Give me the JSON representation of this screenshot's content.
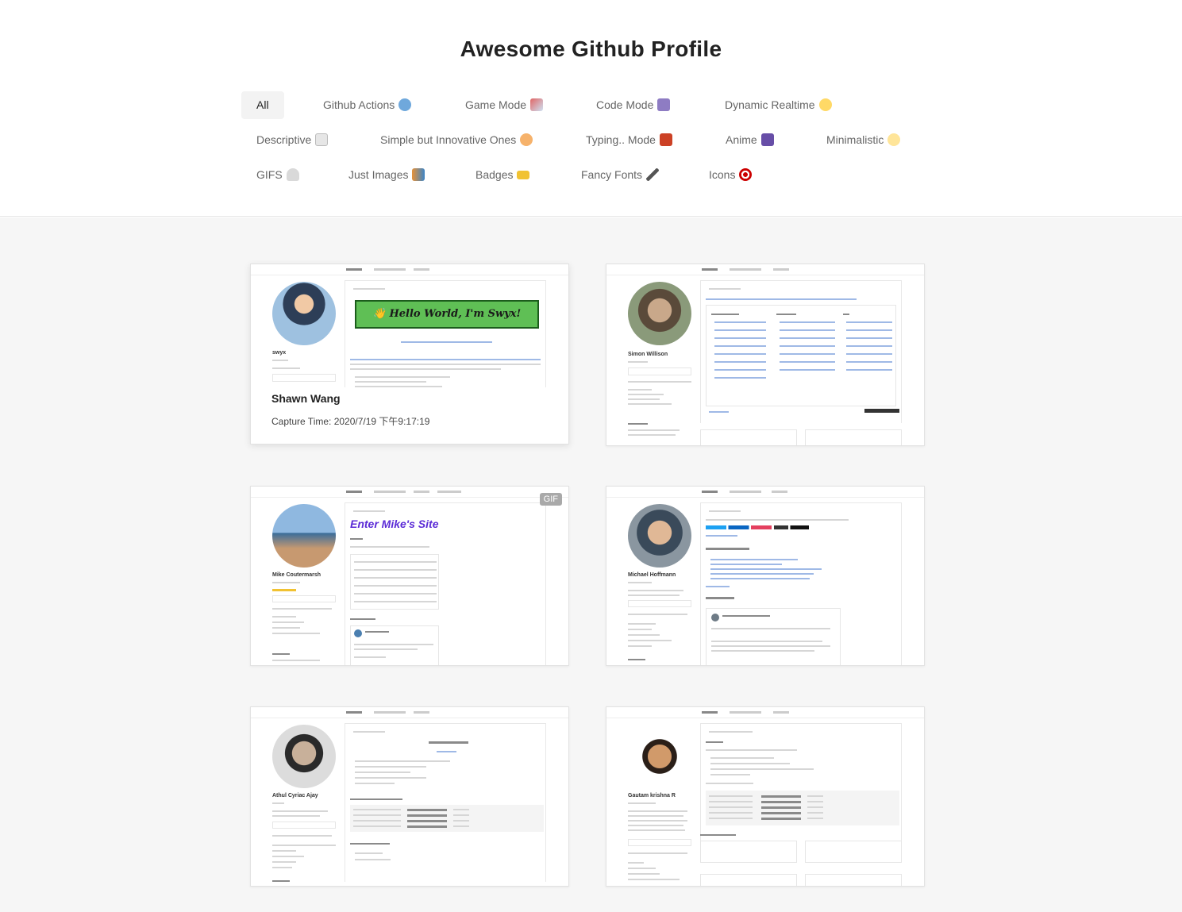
{
  "page": {
    "title": "Awesome Github Profile"
  },
  "filters": {
    "row1": [
      {
        "label": "All",
        "icon": "all",
        "active": true
      },
      {
        "label": "Github Actions",
        "icon": "robot-icon",
        "emoji_color": "#6fa8dc"
      },
      {
        "label": "Game Mode",
        "icon": "rocket-icon",
        "emoji_color": "#e06666"
      },
      {
        "label": "Code Mode",
        "icon": "technologist-icon",
        "emoji_color": "#8e7cc3"
      },
      {
        "label": "Dynamic Realtime",
        "icon": "dizzy-icon",
        "emoji_color": "#ffd966"
      }
    ],
    "row2": [
      {
        "label": "Descriptive",
        "icon": "memo-icon",
        "emoji_color": "#cfcfcf"
      },
      {
        "label": "Simple but Innovative Ones",
        "icon": "hugging-face-icon",
        "emoji_color": "#f6b26b"
      },
      {
        "label": "Typing.. Mode",
        "icon": "slot-machine-icon",
        "emoji_color": "#cc4125"
      },
      {
        "label": "Anime",
        "icon": "alien-monster-icon",
        "emoji_color": "#674ea7"
      },
      {
        "label": "Minimalistic",
        "icon": "sparkles-icon",
        "emoji_color": "#ffe599"
      }
    ],
    "row3": [
      {
        "label": "GIFS",
        "icon": "ghost-icon",
        "emoji_color": "#b7b7b7"
      },
      {
        "label": "Just Images",
        "icon": "performing-arts-icon",
        "emoji_color": "#e69138"
      },
      {
        "label": "Badges",
        "icon": "id-card-icon",
        "emoji_color": "#f1c232"
      },
      {
        "label": "Fancy Fonts",
        "icon": "pen-icon",
        "emoji_color": "#666666"
      },
      {
        "label": "Icons",
        "icon": "direct-hit-icon",
        "emoji_color": "#cc0000"
      }
    ]
  },
  "cards": [
    {
      "owner": "Shawn Wang",
      "capture_time": "Capture Time: 2020/7/19 下午9:17:19",
      "mini_name": "swyx",
      "banner_text": "👋 Hello World, I'm Swyx!",
      "avatar_color": "#5a7ea8",
      "show_info": true,
      "gif": false
    },
    {
      "mini_name": "Simon Willison",
      "avatar_color": "#6b5a4a",
      "show_info": false,
      "gif": false
    },
    {
      "mini_name": "Mike Coutermarsh",
      "banner_text": "Enter Mike's Site",
      "avatar_color": "#4a7fb0",
      "show_info": false,
      "gif": true,
      "gif_label": "GIF"
    },
    {
      "mini_name": "Michael Hoffmann",
      "avatar_color": "#6e7b86",
      "show_info": false,
      "gif": false
    },
    {
      "mini_name": "Athul Cyriac Ajay",
      "avatar_color": "#555555",
      "show_info": false,
      "gif": false
    },
    {
      "mini_name": "Gautam krishna R",
      "avatar_color": "#c98d5a",
      "show_info": false,
      "gif": false
    }
  ],
  "colors": {
    "accent_green": "#5fbf55",
    "banner_purple": "#5b2bd6"
  }
}
